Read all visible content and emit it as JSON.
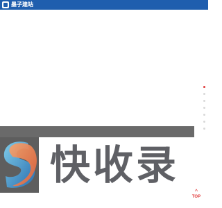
{
  "header": {
    "brand_name": "墨子建站"
  },
  "banner": {
    "logo_text": "快收录"
  },
  "sidebar_dots": {
    "count": 7,
    "active_index": 0
  },
  "back_to_top": {
    "arrow": "^",
    "label": "TOP"
  },
  "colors": {
    "header_bg": "#1f5eae",
    "banner_bg": "#5e5e5e",
    "logo_text": "#5f6065",
    "accent": "#e03a3a"
  },
  "icons": {
    "brand": "site-logo-icon",
    "logo": "s-swirl-logo-icon"
  }
}
